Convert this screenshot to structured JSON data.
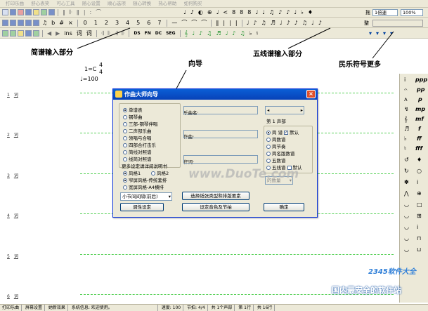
{
  "menu": [
    "打印乐曲",
    "舒心表笑",
    "可心工具",
    "随心设置",
    "顺心选项",
    "随心转换",
    "热心帮助",
    "如何购买"
  ],
  "toolbar1": {
    "symbols": [
      "♩",
      "♪",
      "◐",
      "⊕",
      "♩",
      "<",
      "8",
      "8",
      "8",
      "♩",
      "♩",
      "♫",
      "♪",
      "♪",
      "♩",
      "♭",
      "♦"
    ],
    "tempo_label": "拖",
    "tempo_value": "1倍速",
    "zoom_value": "100%"
  },
  "toolbar2": {
    "jianpu_digits": [
      "0",
      "1",
      "2",
      "3",
      "4",
      "5",
      "6",
      "7"
    ],
    "accidentals": [
      "b",
      "#",
      "×",
      "♮",
      "♮"
    ],
    "right_label": "整"
  },
  "toolbar3": {
    "labels": [
      "ins",
      "词",
      "词"
    ],
    "abbr": [
      "DS",
      "FN",
      "DC",
      "SEG"
    ],
    "notes": [
      "♩",
      "♪",
      "♫",
      "♬",
      "♭",
      "♮"
    ]
  },
  "annotations": {
    "jianpu": "简谱输入部分",
    "wizard": "向导",
    "staff": "五线谱输入部分",
    "folk": "民乐符号更多"
  },
  "score": {
    "key": "1=C",
    "time_top": "4",
    "time_bottom": "4",
    "tempo": "♩=100",
    "rows": [
      {
        "num": "1",
        "label": "词"
      },
      {
        "num": "2",
        "label": "词"
      },
      {
        "num": "3",
        "label": "词"
      },
      {
        "num": "4",
        "label": "词"
      },
      {
        "num": "5",
        "label": "词"
      },
      {
        "num": "6",
        "label": "词"
      }
    ]
  },
  "dialog": {
    "title": "作曲大师向导",
    "close_label": "×",
    "types": [
      "单谱表",
      "钢琴曲",
      "三部-钢琴伴唱",
      "二声部乐曲",
      "领唱与合唱",
      "四部合打击乐",
      "简线对照谱",
      "线简对照谱"
    ],
    "selected_type": 0,
    "style_caption": "更多设定请详阅说明书",
    "style_options": [
      "风格1",
      "风格2"
    ],
    "selected_style": 0,
    "layout_options": [
      "窄屏风格-传统套排",
      "宽屏风格-A4横排"
    ],
    "selected_layout": 0,
    "bar_spacing": "小节间间隔(前后)",
    "title_label": "乐曲名:",
    "composer_label": "作曲:",
    "lyricist_label": "作词:",
    "part_label": "第 1 声部",
    "staff_types": [
      "简 谱",
      "简数谱",
      "简节奏",
      "简名版数谱",
      "五数谱",
      "五线谱"
    ],
    "default_label": "默认",
    "selected_staff": 0,
    "part_count_label": "的数量",
    "buttons": {
      "adjust": "调性设定",
      "paper": "选择纸张类型和排版要素",
      "instrument": "设定音色及节拍",
      "ok": "确定"
    }
  },
  "watermark": "www.DuoTe.com",
  "brand": {
    "logo": "2345软件大全",
    "tagline": "国内最安全的软件站"
  },
  "status": [
    "打印乐曲",
    "屏幕设置",
    "她新效果",
    "系统信息: 欢迎使用。",
    "速度: 100",
    "节拍: 4/4",
    "共 1个声部",
    "第 1行",
    "共 16行"
  ]
}
